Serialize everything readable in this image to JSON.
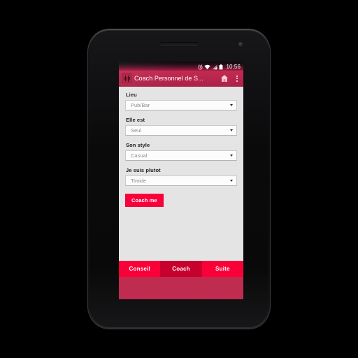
{
  "device": {
    "name": "android-phone",
    "earpiece": "earpiece-speaker",
    "camera": "front-camera"
  },
  "status_bar": {
    "time": "10:56",
    "icons": [
      "alarm-icon",
      "wifi-icon",
      "signal-icon",
      "battery-icon"
    ]
  },
  "action_bar": {
    "app_icon": "equalizer-app-icon",
    "title": "Coach Personnel de S...",
    "home_action": "home-icon",
    "overflow": "overflow-menu-icon"
  },
  "form": {
    "fields": [
      {
        "label": "Lieu",
        "value": "Pub/Bar"
      },
      {
        "label": "Elle est",
        "value": "Seul"
      },
      {
        "label": "Son style",
        "value": "Casual"
      },
      {
        "label": "Je suis plutot",
        "value": "Timide"
      }
    ],
    "submit_label": "Coach me"
  },
  "tabs": [
    {
      "label": "Conseil",
      "selected": false
    },
    {
      "label": "Coach",
      "selected": true
    },
    {
      "label": "Suite",
      "selected": false
    }
  ],
  "nav_bar": {
    "back": "back-icon",
    "home": "home-icon",
    "recents": "recents-icon"
  },
  "colors": {
    "accent_pink": "#fa0039",
    "accent_dark": "#c8002e",
    "action_bar": "#b9264d",
    "content_bg": "#e4e4e4",
    "filler": "#bf2c50"
  }
}
